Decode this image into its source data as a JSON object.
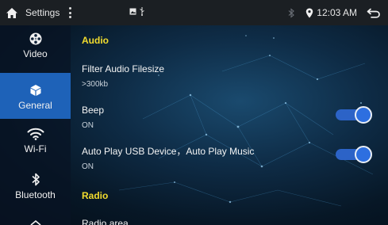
{
  "statusbar": {
    "title": "Settings",
    "time": "12:03 AM"
  },
  "sidebar": {
    "items": [
      {
        "label": "Video",
        "icon": "film-reel-icon",
        "active": false
      },
      {
        "label": "General",
        "icon": "cube-icon",
        "active": true
      },
      {
        "label": "Wi-Fi",
        "icon": "wifi-icon",
        "active": false
      },
      {
        "label": "Bluetooth",
        "icon": "bluetooth-icon",
        "active": false
      }
    ]
  },
  "content": {
    "section_audio": "Audio",
    "filter_title": "Filter Audio Filesize",
    "filter_value": ">300kb",
    "beep_title": "Beep",
    "beep_value": "ON",
    "beep_enabled": true,
    "autoplay_title": "Auto Play USB Device，Auto Play Music",
    "autoplay_value": "ON",
    "autoplay_enabled": true,
    "section_radio": "Radio",
    "radio_area_title": "Radio area"
  },
  "colors": {
    "accent": "#1e62b8",
    "section_title": "#f2dc2e",
    "toggle_on": "#2d6fe0"
  }
}
